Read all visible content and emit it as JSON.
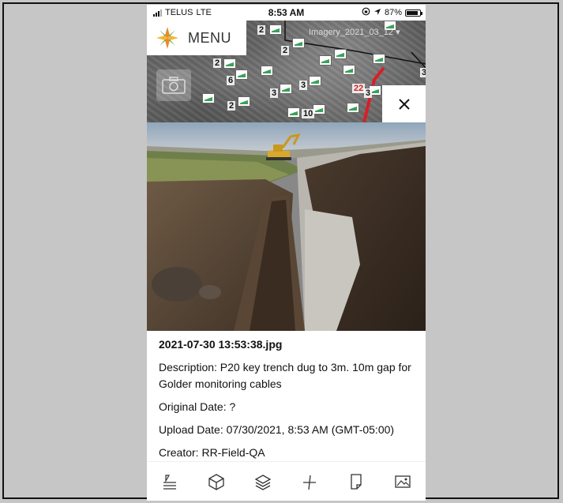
{
  "status_bar": {
    "carrier": "TELUS",
    "network": "LTE",
    "time": "8:53 AM",
    "battery": "87%"
  },
  "map": {
    "menu_label": "MENU",
    "imagery_selector": "Imagery_2021_03_12",
    "clusters": [
      "2",
      "2",
      "2",
      "6",
      "3",
      "3",
      "2",
      "10",
      "3",
      "3"
    ],
    "red_label": "22"
  },
  "photo": {
    "icon": "photo-image"
  },
  "details": {
    "filename": "2021-07-30 13:53:38.jpg",
    "description": "Description: P20 key trench dug to 3m. 10m gap for Golder monitoring cables",
    "original_date": "Original Date: ?",
    "upload_date": "Upload Date: 07/30/2021, 8:53 AM (GMT-05:00)",
    "creator": "Creator: RR-Field-QA"
  },
  "toolbar": {
    "items": [
      "edit-icon",
      "cube-icon",
      "layers-icon",
      "measure-icon",
      "note-icon",
      "image-icon"
    ]
  },
  "colors": {
    "accent_red": "#d81f26",
    "marker_green": "#3aa15a",
    "logo_orange": "#e8892a",
    "logo_green": "#5aa043"
  }
}
